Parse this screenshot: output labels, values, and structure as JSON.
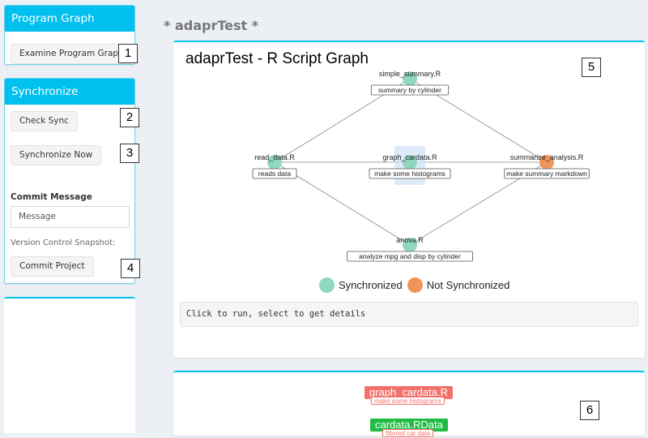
{
  "sidebar": {
    "program_graph": {
      "title": "Program Graph",
      "examine_button": "Examine Program Graph",
      "marker": "1"
    },
    "synchronize": {
      "title": "Synchronize",
      "check_sync_button": "Check Sync",
      "check_sync_marker": "2",
      "sync_now_button": "Synchronize Now",
      "sync_now_marker": "3",
      "commit_message_label": "Commit Message",
      "commit_message_placeholder": "Message",
      "snapshot_label": "Version Control Snapshot:",
      "commit_button": "Commit Project",
      "commit_marker": "4"
    }
  },
  "main": {
    "page_title": "* adaprTest *",
    "graph_panel": {
      "title": "adaprTest - R Script Graph",
      "marker": "5",
      "colors": {
        "synchronized": "#8fd8bd",
        "not_synchronized": "#f0955a",
        "edge": "#888888"
      },
      "nodes": [
        {
          "id": "simple_summary",
          "label": "simple_summary.R",
          "description": "summary by cylinder",
          "status": "synchronized"
        },
        {
          "id": "read_data",
          "label": "read_data.R",
          "description": "reads data",
          "status": "synchronized"
        },
        {
          "id": "graph_cardata",
          "label": "graph_cardata.R",
          "description": "make some histograms",
          "status": "synchronized",
          "selected": true
        },
        {
          "id": "summarize_analysis",
          "label": "summarize_analysis.R",
          "description": "make summary markdown",
          "status": "not_synchronized"
        },
        {
          "id": "anova",
          "label": "anova.R",
          "description": "analyze mpg and disp by cylinder",
          "status": "synchronized"
        }
      ],
      "edges": [
        [
          "read_data",
          "simple_summary"
        ],
        [
          "read_data",
          "graph_cardata"
        ],
        [
          "read_data",
          "anova"
        ],
        [
          "simple_summary",
          "summarize_analysis"
        ],
        [
          "graph_cardata",
          "summarize_analysis"
        ],
        [
          "anova",
          "summarize_analysis"
        ]
      ],
      "legend": [
        {
          "label": "Synchronized",
          "color": "#8fd8bd"
        },
        {
          "label": "Not Synchronized",
          "color": "#f0955a"
        }
      ],
      "info_text": "Click to run, select to get details"
    },
    "detail_panel": {
      "marker": "6",
      "items": [
        {
          "name": "graph_cardata.R",
          "description": "make some histograms",
          "color": "#f2716b"
        },
        {
          "name": "cardata.RData",
          "description": "filtered car data",
          "color": "#22bb44"
        }
      ]
    }
  }
}
